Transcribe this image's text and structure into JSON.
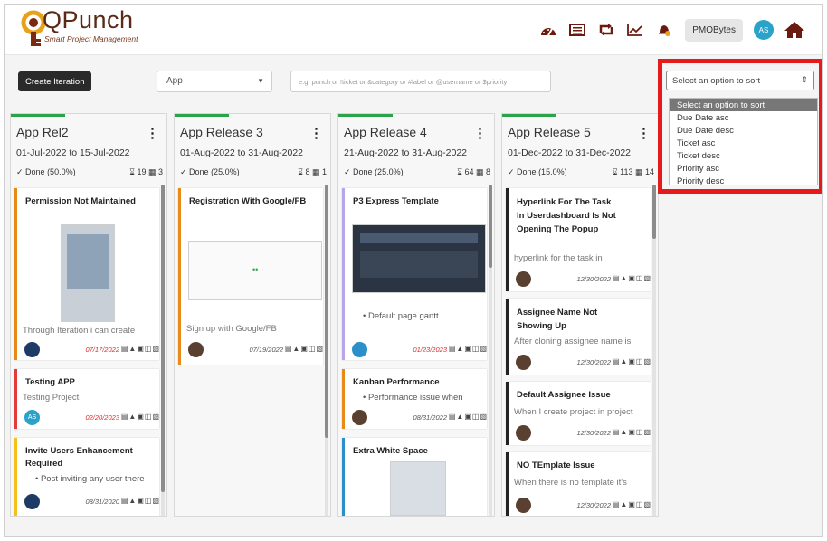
{
  "app": {
    "title": "QPunch",
    "subtitle": "Smart Project Management",
    "user_label": "PMOBytes",
    "user_initials": "AS"
  },
  "header_icons": [
    "dashboard-icon",
    "list-icon",
    "repeat-icon",
    "chart-line-icon",
    "bell-icon"
  ],
  "toolbar": {
    "create_iteration": "Create Iteration",
    "app_select_value": "App",
    "search_placeholder": "e.g: punch or !ticket or &category or #label or @username or $priority"
  },
  "sort": {
    "placeholder": "Select an option to sort",
    "options": [
      "Select an option to sort",
      "Due Date asc",
      "Due Date desc",
      "Ticket asc",
      "Ticket desc",
      "Priority asc",
      "Priority desc"
    ],
    "active_index": 0
  },
  "columns": [
    {
      "title": "App Rel2",
      "dates": "01-Jul-2022 to 15-Jul-2022",
      "status": "Done (50.0%)",
      "hours": "19",
      "tickets": "3",
      "cards": [
        {
          "title": "Permission Not Maintained",
          "desc": "Through Iteration i can create",
          "date": "07/17/2022",
          "date_red": true,
          "avatar": "",
          "border": "#e88a1a"
        },
        {
          "title": "Testing APP",
          "desc": "Testing Project",
          "date": "02/20/2023",
          "date_red": true,
          "avatar": "AS",
          "border": "#e23b3b"
        },
        {
          "title": "Invite Users Enhancement Required",
          "bullet": "Post inviting any user there",
          "date": "08/31/2020",
          "date_red": false,
          "avatar": "",
          "border": "#f2c21a"
        }
      ]
    },
    {
      "title": "App Release 3",
      "dates": "01-Aug-2022 to 31-Aug-2022",
      "status": "Done (25.0%)",
      "hours": "8",
      "tickets": "1",
      "cards": [
        {
          "title": "Registration With Google/FB",
          "desc": "Sign up with Google/FB",
          "date": "07/19/2022",
          "date_red": false,
          "avatar": "",
          "border": "#e88a1a"
        }
      ]
    },
    {
      "title": "App Release 4",
      "dates": "21-Aug-2022 to 31-Aug-2022",
      "status": "Done (25.0%)",
      "hours": "64",
      "tickets": "8",
      "cards": [
        {
          "title": "P3 Express Template",
          "bullet": "Default page gantt",
          "date": "01/23/2023",
          "date_red": true,
          "avatar": "",
          "border": "#b9a6e8"
        },
        {
          "title": "Kanban Performance",
          "bullet": "Performance issue when",
          "date": "08/31/2022",
          "date_red": false,
          "avatar": "",
          "border": "#e88a1a"
        },
        {
          "title": "Extra White Space",
          "date": "",
          "date_red": false,
          "avatar": "",
          "border": "#2b8fc9"
        }
      ]
    },
    {
      "title": "App Release 5",
      "dates": "01-Dec-2022 to 31-Dec-2022",
      "status": "Done (15.0%)",
      "hours": "113",
      "tickets": "14",
      "cards": [
        {
          "title": "Hyperlink For The Task In Userdashboard Is Not Opening The Popup",
          "desc": "hyperlink for the task in",
          "date": "12/30/2022",
          "date_red": false,
          "avatar": "",
          "border": "#222"
        },
        {
          "title": "Assignee Name Not Showing Up",
          "desc": "After cloning assignee name is",
          "date": "12/30/2022",
          "date_red": false,
          "avatar": "",
          "border": "#222"
        },
        {
          "title": "Default Assignee Issue",
          "desc": "When I create project in project",
          "date": "12/30/2022",
          "date_red": false,
          "avatar": "",
          "border": "#222"
        },
        {
          "title": "NO TEmplate Issue",
          "desc": "When there is no template it's",
          "date": "12/30/2022",
          "date_red": false,
          "avatar": "",
          "border": "#222"
        }
      ]
    }
  ],
  "colors": {
    "accent_brand": "#5a2a17",
    "highlight": "#e51b1b",
    "progress": "#2aa34a"
  }
}
